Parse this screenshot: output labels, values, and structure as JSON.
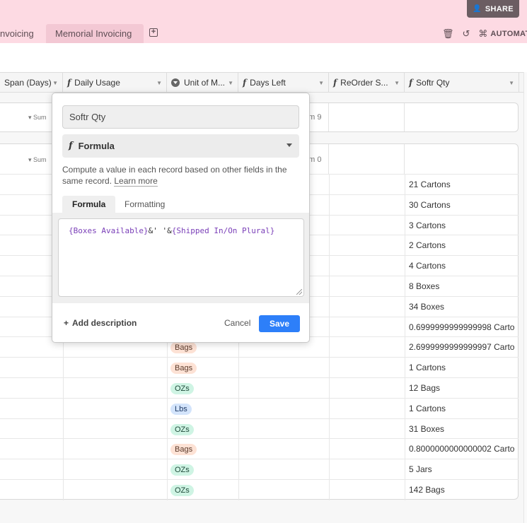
{
  "header": {
    "share_label": "SHARE",
    "tabs": [
      {
        "label": "nvoicing"
      },
      {
        "label": "Memorial Invoicing"
      }
    ],
    "automation_label": "AUTOMAT"
  },
  "columns": [
    {
      "label": "Span (Days)"
    },
    {
      "label": "Daily Usage"
    },
    {
      "label": "Unit of M..."
    },
    {
      "label": "Days Left"
    },
    {
      "label": "ReOrder S..."
    },
    {
      "label": "Softr Qty"
    }
  ],
  "groups": [
    {
      "summary_left": "Sum",
      "summary_right": "um 9"
    },
    {
      "summary_left": "Sum",
      "summary_right": "um 0"
    }
  ],
  "rows": [
    {
      "unit": "",
      "qty": "21 Cartons"
    },
    {
      "unit": "",
      "qty": "30 Cartons"
    },
    {
      "unit": "",
      "qty": "3 Cartons"
    },
    {
      "unit": "",
      "qty": "2 Cartons"
    },
    {
      "unit": "",
      "qty": "4 Cartons"
    },
    {
      "unit": "",
      "qty": "8 Boxes"
    },
    {
      "unit": "",
      "qty": "34 Boxes"
    },
    {
      "unit": "",
      "qty": "0.6999999999999998 Carto..."
    },
    {
      "unit": "Bags",
      "qty": "2.6999999999999997 Carto..."
    },
    {
      "unit": "Bags",
      "qty": "1 Cartons"
    },
    {
      "unit": "OZs",
      "qty": "12 Bags"
    },
    {
      "unit": "Lbs",
      "qty": "1 Cartons"
    },
    {
      "unit": "OZs",
      "qty": "31 Boxes"
    },
    {
      "unit": "Bags",
      "qty": "0.8000000000000002 Carto..."
    },
    {
      "unit": "OZs",
      "qty": "5 Jars"
    },
    {
      "unit": "OZs",
      "qty": "142 Bags"
    }
  ],
  "popup": {
    "field_name": "Softr Qty",
    "field_type": "Formula",
    "description": "Compute a value in each record based on other fields in the same record.",
    "learn_more": "Learn more",
    "tab_formula": "Formula",
    "tab_formatting": "Formatting",
    "formula_part1": "{Boxes Available}",
    "formula_part2": "&' '&",
    "formula_part3": "{Shipped In/On Plural}",
    "add_description": "Add description",
    "cancel": "Cancel",
    "save": "Save"
  },
  "colors": {
    "header_bg": "#fddae3",
    "save_blue": "#2d7ff9",
    "bags_pill": "#fde2d5",
    "ozs_pill": "#cff4e4",
    "lbs_pill": "#d3e4fb"
  }
}
